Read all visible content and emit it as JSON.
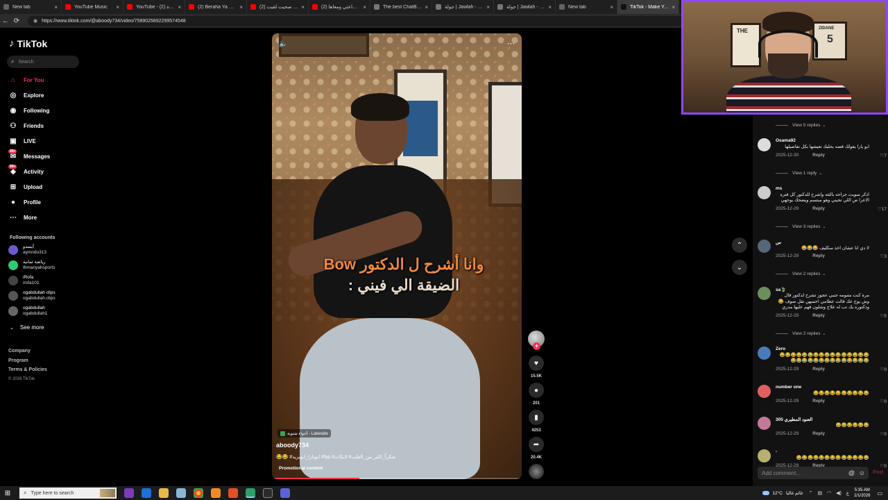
{
  "browser": {
    "tabs": [
      {
        "label": "New tab",
        "color": "#5f6368",
        "active": false
      },
      {
        "label": "YouTube Music",
        "color": "#ff0000",
        "active": false
      },
      {
        "label": "YouTube - (2) سنة جديدة",
        "color": "#ff0000",
        "active": false
      },
      {
        "label": "(2) Beraha Ya Sheekha",
        "color": "#ff0000",
        "active": false
      },
      {
        "label": "(2) سويان وانا صحيت لقيت",
        "color": "#ff0000",
        "active": false
      },
      {
        "label": "(2) ولدت ساعتي ومعاها",
        "color": "#ff0000",
        "active": false
      },
      {
        "label": "The best ChatBot and",
        "color": "#777777",
        "active": false
      },
      {
        "label": "جولة | Jawlah - منصة",
        "color": "#777777",
        "active": false
      },
      {
        "label": "جولة | Jawlah - منصة",
        "color": "#777777",
        "active": false
      },
      {
        "label": "New tab",
        "color": "#5f6368",
        "active": false
      },
      {
        "label": "TikTok - Make Your Day",
        "color": "#111111",
        "active": true
      }
    ],
    "url": "https://www.tiktok.com/@aboody734/video/7589025892299574548"
  },
  "sidebar": {
    "logo": "TikTok",
    "search_placeholder": "Search",
    "nav": [
      {
        "label": "For You",
        "icon": "home-icon",
        "active": true,
        "badge": ""
      },
      {
        "label": "Explore",
        "icon": "compass-icon",
        "active": false,
        "badge": ""
      },
      {
        "label": "Following",
        "icon": "following-icon",
        "active": false,
        "badge": ""
      },
      {
        "label": "Friends",
        "icon": "friends-icon",
        "active": false,
        "badge": ""
      },
      {
        "label": "LIVE",
        "icon": "live-icon",
        "active": false,
        "badge": ""
      },
      {
        "label": "Messages",
        "icon": "messages-icon",
        "active": false,
        "badge": "99+"
      },
      {
        "label": "Activity",
        "icon": "activity-icon",
        "active": false,
        "badge": "99+"
      },
      {
        "label": "Upload",
        "icon": "upload-icon",
        "active": false,
        "badge": ""
      },
      {
        "label": "Profile",
        "icon": "profile-icon",
        "active": false,
        "badge": ""
      },
      {
        "label": "More",
        "icon": "more-icon",
        "active": false,
        "badge": ""
      }
    ],
    "following_title": "Following accounts",
    "accounts": [
      {
        "name": "أيمندو",
        "handle": "aymndo313",
        "color": "#6a5acd"
      },
      {
        "name": "رياضة ثمانية",
        "handle": "thmanyahsports",
        "color": "#2ecc71"
      },
      {
        "name": "iRofa",
        "handle": "irofa101",
        "color": "#444444"
      },
      {
        "name": "ogabdullah clips",
        "handle": "ogabdullah.clips",
        "color": "#555555"
      },
      {
        "name": "ogabdullah",
        "handle": "ogabdullah1",
        "color": "#666666"
      }
    ],
    "see_more": "See more",
    "footer": [
      "Company",
      "Program",
      "Terms & Policies"
    ],
    "copyright": "© 2026 TikTok"
  },
  "video": {
    "caption_line1": "وانا أشرح ل الدكتور Bow",
    "caption_line2": "الضيقة الي فيني :",
    "music": "أجواء شتوية - Lakeside",
    "username": "aboody734",
    "description": "شكراً_لكم_من_القلب# لايكات# fyp# ابوبارا_ابوبزيد# 😂😂",
    "promo": "Promotional content",
    "progress": 0.35
  },
  "actions": {
    "likes": "15.5K",
    "comments": "201",
    "saves": "4253",
    "shares": "20.4K"
  },
  "comments": {
    "items": [
      {
        "view_replies": "View 5 replies",
        "user": "",
        "text": "",
        "date": "",
        "likes": ""
      },
      {
        "user": "Osama92",
        "text": "ابو يارا يقولك قصه بحليك تعيشها بكل تفاصيلها",
        "date": "2025-12-30",
        "reply": "Reply",
        "likes": "7",
        "color": "#dddddd"
      },
      {
        "view_replies": "View 1 reply"
      },
      {
        "user": "ms",
        "text": "اذكر سويت جراحه بالثثه واشرح للدكتور كل فتره الاعرا ض اللي تجيني وهو مبتسم ويضحك بوجهي",
        "date": "2025-12-29",
        "reply": "Reply",
        "likes": "17",
        "color": "#cccccc"
      },
      {
        "view_replies": "View 3 replies"
      },
      {
        "user": "س",
        "text": "لا دي انا عشان اخذ سكليف 😂😂😂",
        "date": "2025-12-29",
        "reply": "Reply",
        "likes": "3",
        "color": "#556677"
      },
      {
        "view_replies": "View 2 replies"
      },
      {
        "user": "sa🍃",
        "text": "مرة كنت متنومه جنبي عجوز تشرح لدكتور قال وش يوج عك قالت عظامي احسهن تقل صوف 😂 ودكتوره يك تب له علاج وشلون فهم عليها مدري",
        "date": "2025-12-29",
        "reply": "Reply",
        "likes": "5",
        "color": "#6b8e5a"
      },
      {
        "view_replies": "View 2 replies"
      },
      {
        "user": "Zero",
        "text": "😂😂😂😂😂😂😂😂😂😂😂😂😂😂😂😂😂😂😂😂😂😂😂😂😂😂😂😂😂😂",
        "date": "2025-12-29",
        "reply": "Reply",
        "likes": "0",
        "color": "#4a7ab8"
      },
      {
        "user": "number one",
        "text": "😂😂😂😂😂😂😂😂😂😂",
        "date": "2025-12-29",
        "reply": "Reply",
        "likes": "0",
        "color": "#e06060"
      },
      {
        "user": "العنود المطيري 305",
        "text": "😂😂😂😂😂😂",
        "date": "2025-12-29",
        "reply": "Reply",
        "likes": "0",
        "color": "#c27a9a"
      },
      {
        "user": "-",
        "text": "😂😂😂😂😂😂😂😂😂😂😂😂😂",
        "date": "2025-12-29",
        "reply": "Reply",
        "likes": "0",
        "color": "#b8b070"
      }
    ],
    "add_placeholder": "Add comment...",
    "post": "Post"
  },
  "webcam": {
    "poster1": "THE",
    "poster2": "ZIDANE",
    "poster2_num": "5"
  },
  "taskbar": {
    "search_placeholder": "Type here to search",
    "temperature": "12°C",
    "weather": "غائم غالبا",
    "time": "5:35 AM",
    "date": "1/1/2026"
  }
}
